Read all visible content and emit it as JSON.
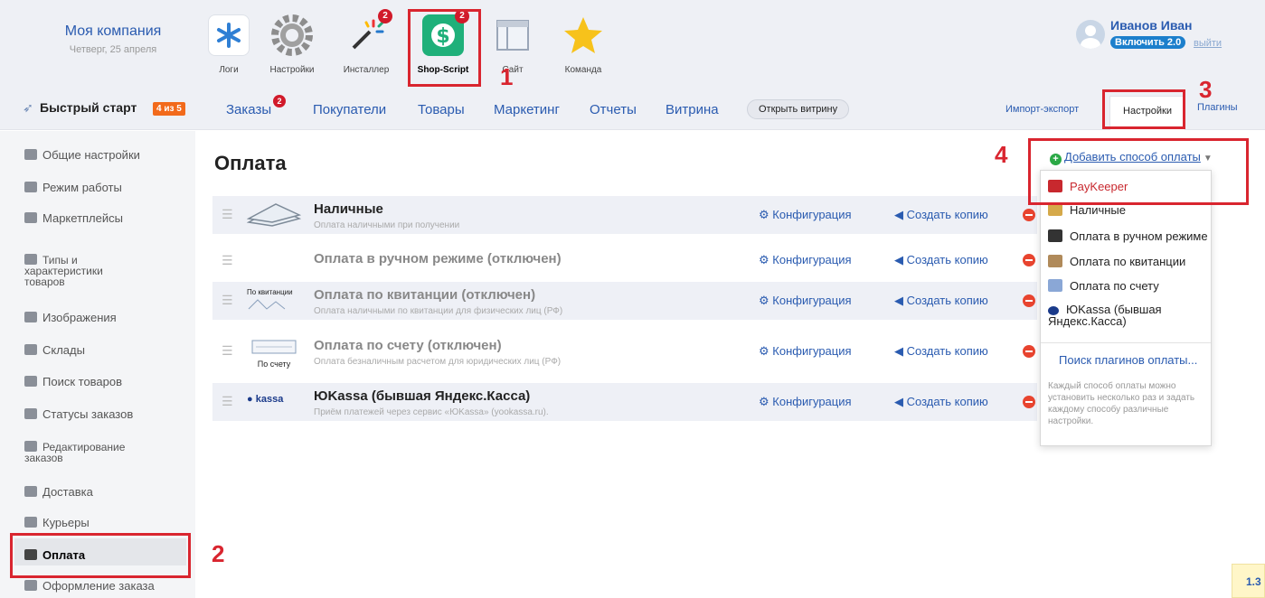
{
  "company": {
    "name": "Моя компания",
    "date": "Четверг, 25 апреля"
  },
  "apps": [
    {
      "label": "Логи",
      "icon": "asterisk-icon"
    },
    {
      "label": "Настройки",
      "icon": "gear-icon"
    },
    {
      "label": "Инсталлер",
      "icon": "magic-wand-icon",
      "badge": "2"
    },
    {
      "label": "Shop-Script",
      "icon": "dollar-icon",
      "badge": "2"
    },
    {
      "label": "Сайт",
      "icon": "browser-window-icon"
    },
    {
      "label": "Команда",
      "icon": "star-person-icon"
    }
  ],
  "user": {
    "name": "Иванов Иван",
    "enable_label": "Включить 2.0",
    "logout": "выйти"
  },
  "nav": {
    "quick_start": "Быстрый старт",
    "steps": "4 из 5",
    "orders": "Заказы",
    "orders_badge": "2",
    "customers": "Покупатели",
    "products": "Товары",
    "marketing": "Маркетинг",
    "reports": "Отчеты",
    "storefront": "Витрина",
    "open_storefront": "Открыть витрину",
    "import_export": "Импорт-экспорт",
    "settings": "Настройки",
    "plugins": "Плагины"
  },
  "sidebar": [
    {
      "label": "Общие настройки",
      "icon": "cogs-icon"
    },
    {
      "label": "Режим работы",
      "icon": "calendar-icon"
    },
    {
      "label": "Маркетплейсы",
      "icon": "marketplace-icon"
    },
    {
      "label": "Типы и\nхарактеристики\nтоваров",
      "icon": "list-icon"
    },
    {
      "label": "Изображения",
      "icon": "images-icon"
    },
    {
      "label": "Склады",
      "icon": "box-icon"
    },
    {
      "label": "Поиск товаров",
      "icon": "search-icon"
    },
    {
      "label": "Статусы заказов",
      "icon": "flag-icon"
    },
    {
      "label": "Редактирование\nзаказов",
      "icon": "layers-icon"
    },
    {
      "label": "Доставка",
      "icon": "truck-icon"
    },
    {
      "label": "Курьеры",
      "icon": "courier-icon"
    },
    {
      "label": "Оплата",
      "icon": "wallet-icon",
      "active": true
    },
    {
      "label": "Оформление заказа",
      "icon": "cart-icon"
    }
  ],
  "page": {
    "title": "Оплата"
  },
  "payments": [
    {
      "name": "Наличные",
      "desc": "Оплата наличными при получении",
      "disabled": false,
      "thumb": "cash-icon"
    },
    {
      "name": "Оплата в ручном режиме (отключен)",
      "desc": "",
      "disabled": true,
      "thumb": ""
    },
    {
      "name": "Оплата по квитанции (отключен)",
      "desc": "Оплата наличными по квитанции для физических лиц (РФ)",
      "disabled": true,
      "thumb": "receipt-icon",
      "thumb_text": "По квитанции"
    },
    {
      "name": "Оплата по счету (отключен)",
      "desc": "Оплата безналичным расчетом для юридических лиц (РФ)",
      "disabled": true,
      "thumb": "invoice-icon",
      "thumb_text": "По счету"
    },
    {
      "name": "ЮKassa (бывшая Яндекс.Касса)",
      "desc": "Приём платежей через сервис «ЮKassa» (yookassa.ru).",
      "disabled": false,
      "thumb": "yookassa-logo",
      "thumb_text": "kassa"
    }
  ],
  "row_actions": {
    "configure": "Конфигурация",
    "copy": "Создать копию"
  },
  "add_menu": {
    "button": "Добавить способ оплаты",
    "items": [
      {
        "label": "PayKeeper",
        "icon": "paykeeper-icon",
        "color": "#c8282e"
      },
      {
        "label": "Наличные",
        "icon": "cash-icon",
        "color": "#d5a94a"
      },
      {
        "label": "Оплата в ручном режиме",
        "icon": "wallet-icon",
        "color": "#333333"
      },
      {
        "label": "Оплата по квитанции",
        "icon": "receipt-icon",
        "color": "#b08a5a"
      },
      {
        "label": "Оплата по счету",
        "icon": "document-icon",
        "color": "#8aa7d6"
      },
      {
        "label": "ЮKassa (бывшая\nЯндекс.Касса)",
        "icon": "yookassa-icon",
        "color": "#1a3a8a"
      }
    ],
    "search": "Поиск плагинов оплаты...",
    "note": "Каждый способ оплаты можно установить несколько раз и задать каждому способу различные настройки."
  },
  "annotations": [
    "1",
    "2",
    "3",
    "4"
  ],
  "version": "1.3",
  "colors": {
    "accent_blue": "#2a5bb0",
    "annotation_red": "#d9252f",
    "badge_red": "#d11a2a",
    "orange_steps": "#f26a1b",
    "shop_script_green": "#1fb07a"
  }
}
